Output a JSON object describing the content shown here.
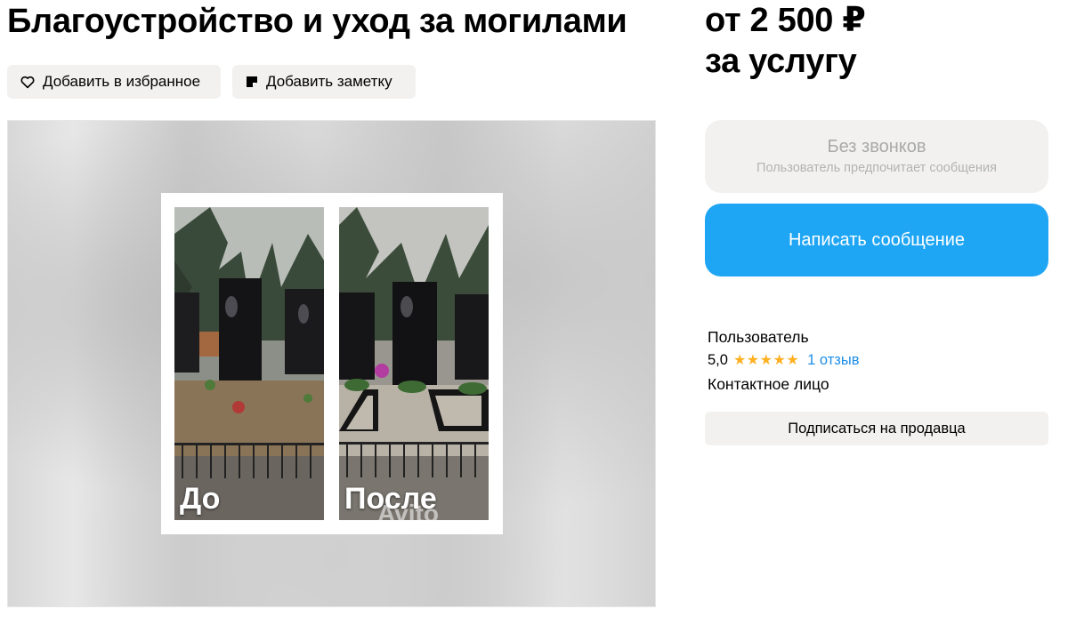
{
  "listing": {
    "title": "Благоустройство и уход за могилами",
    "price_line1": "от 2 500 ₽",
    "price_line2": "за услугу"
  },
  "actions": {
    "favorite_label": "Добавить в избранное",
    "note_label": "Добавить заметку"
  },
  "gallery": {
    "before_label": "До",
    "after_label": "После",
    "watermark": "Avito"
  },
  "contact": {
    "no_calls_title": "Без звонков",
    "no_calls_subtitle": "Пользователь предпочитает сообщения",
    "message_button": "Написать сообщение",
    "message_button_color": "#1ea6f5"
  },
  "seller": {
    "name": "Пользователь",
    "rating": "5,0",
    "stars": 5,
    "reviews": "1 отзыв",
    "role": "Контактное лицо",
    "subscribe_label": "Подписаться на продавца"
  },
  "colors": {
    "accent": "#1ea6f5",
    "star": "#ffb021",
    "link": "#1e8ee6",
    "chip_bg": "#f2f1f0"
  }
}
